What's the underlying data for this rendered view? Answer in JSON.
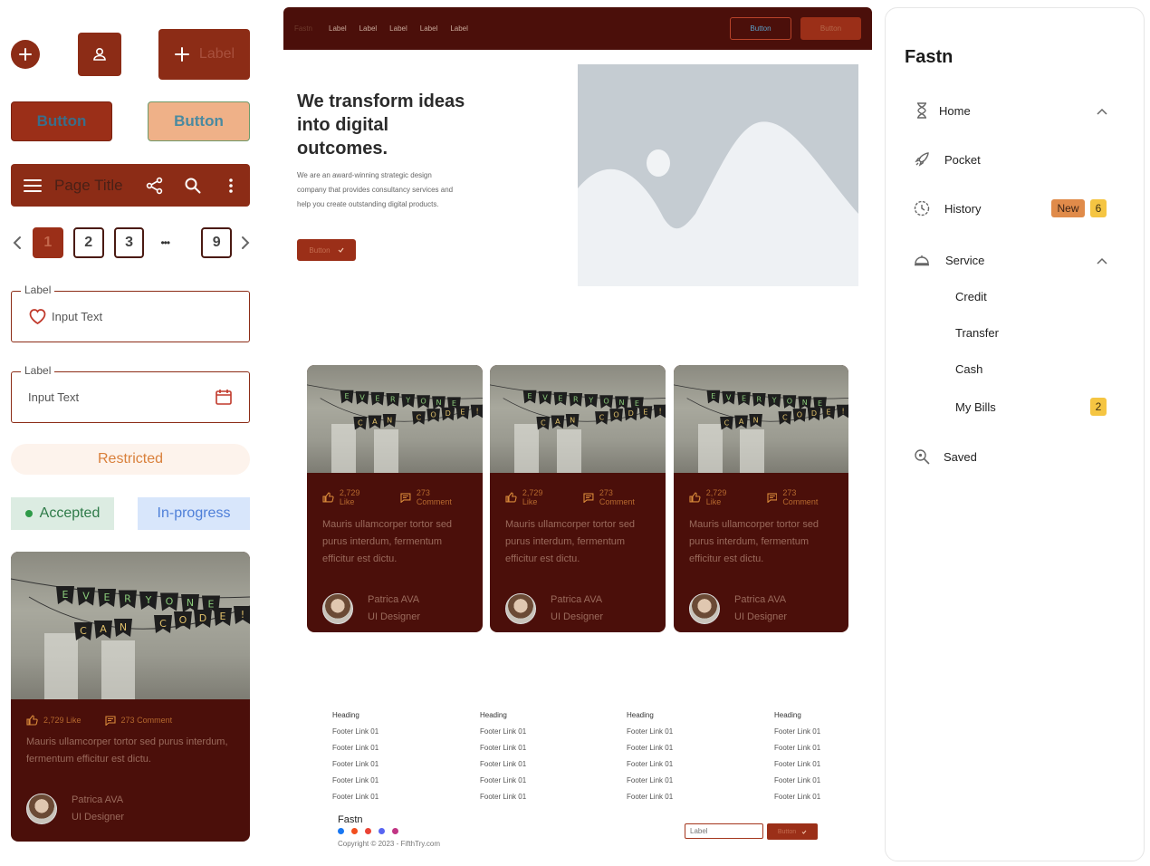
{
  "left": {
    "fab_label": "Label",
    "button_filled": "Button",
    "button_soft": "Button",
    "appbar_title": "Page Title",
    "pagination": {
      "pages": [
        "1",
        "2",
        "3",
        "9"
      ],
      "ellipsis": "•••",
      "active": "1"
    },
    "input1": {
      "label": "Label",
      "value": "Input Text"
    },
    "input2": {
      "label": "Label",
      "value": "Input Text"
    },
    "chip_restricted": "Restricted",
    "chip_accepted": "Accepted",
    "chip_progress": "In-progress"
  },
  "card": {
    "likes": "2,729 Like",
    "comments": "273 Comment",
    "body": "Mauris ullamcorper tortor sed purus interdum, fermentum efficitur est dictu.",
    "author_name": "Patrica AVA",
    "author_role": "UI Designer",
    "banner_top": "EVERYONE",
    "banner_bottom": "CAN CODE"
  },
  "web": {
    "nav": {
      "brand": "Fastn",
      "links": [
        "Label",
        "Label",
        "Label",
        "Label",
        "Label"
      ],
      "button_outline": "Button",
      "button_filled": "Button"
    },
    "hero": {
      "title": "We transform ideas into digital outcomes.",
      "description": "We are an award-winning strategic design company that provides consultancy services and help you create outstanding digital products.",
      "button": "Button"
    },
    "footer": {
      "columns": [
        {
          "heading": "Heading",
          "links": [
            "Footer Link 01",
            "Footer Link 01",
            "Footer Link 01",
            "Footer Link 01",
            "Footer Link 01"
          ]
        },
        {
          "heading": "Heading",
          "links": [
            "Footer Link 01",
            "Footer Link 01",
            "Footer Link 01",
            "Footer Link 01",
            "Footer Link 01"
          ]
        },
        {
          "heading": "Heading",
          "links": [
            "Footer Link 01",
            "Footer Link 01",
            "Footer Link 01",
            "Footer Link 01",
            "Footer Link 01"
          ]
        },
        {
          "heading": "Heading",
          "links": [
            "Footer Link 01",
            "Footer Link 01",
            "Footer Link 01",
            "Footer Link 01",
            "Footer Link 01"
          ]
        }
      ],
      "brand": "Fastn",
      "copyright": "Copyright © 2023 - FifthTry.com",
      "input_placeholder": "Label",
      "button": "Button",
      "social_colors": [
        "#1877f2",
        "#f24e1e",
        "#ea4335",
        "#5865f2",
        "#c13584"
      ]
    }
  },
  "sidebar": {
    "brand": "Fastn",
    "items": {
      "home": "Home",
      "pocket": "Pocket",
      "history": "History",
      "history_badge": "New",
      "history_count": "6",
      "service": "Service",
      "credit": "Credit",
      "transfer": "Transfer",
      "cash": "Cash",
      "mybills": "My Bills",
      "mybills_count": "2",
      "saved": "Saved"
    }
  },
  "colors": {
    "brand": "#8c2c16",
    "dark": "#4b0f0a",
    "accent_orange": "#e08b4a",
    "badge_yellow": "#f5c542"
  }
}
